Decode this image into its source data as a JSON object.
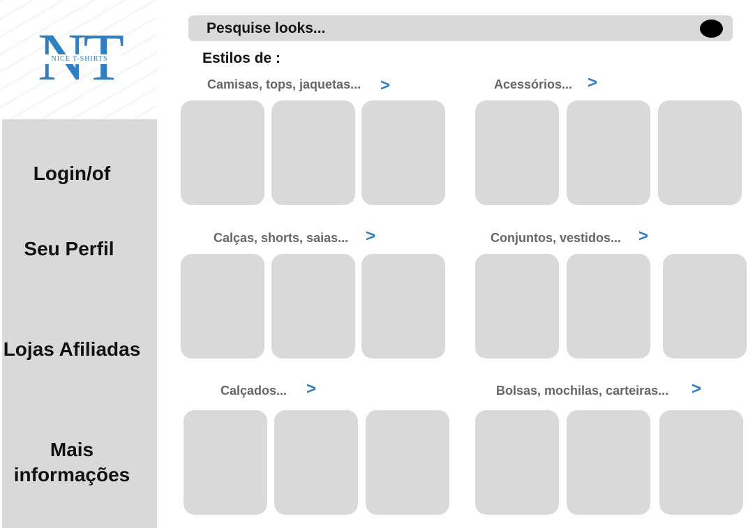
{
  "logo": {
    "letters": "NT",
    "tagline": "NICE T-SHIRTS"
  },
  "sidebar": {
    "items": [
      {
        "label": "Login/of"
      },
      {
        "label": "Seu Perfil"
      },
      {
        "label": "Lojas Afiliadas"
      },
      {
        "label": "Mais informações"
      }
    ]
  },
  "search": {
    "placeholder": "Pesquise looks..."
  },
  "styles_heading": "Estilos de :",
  "categories": [
    {
      "label": "Camisas, tops, jaquetas...",
      "arrow": ">"
    },
    {
      "label": "Acessórios...",
      "arrow": ">"
    },
    {
      "label": "Calças, shorts, saias...",
      "arrow": ">"
    },
    {
      "label": "Conjuntos, vestidos...",
      "arrow": ">"
    },
    {
      "label": "Calçados...",
      "arrow": ">"
    },
    {
      "label": "Bolsas, mochilas, carteiras...",
      "arrow": ">"
    }
  ],
  "colors": {
    "accent": "#2f7fc1",
    "placeholder_gray": "#d9d9d9",
    "label_gray": "#666666"
  },
  "icons": {
    "search_button": "black-circle-icon",
    "category_arrow": "chevron-right-icon"
  }
}
